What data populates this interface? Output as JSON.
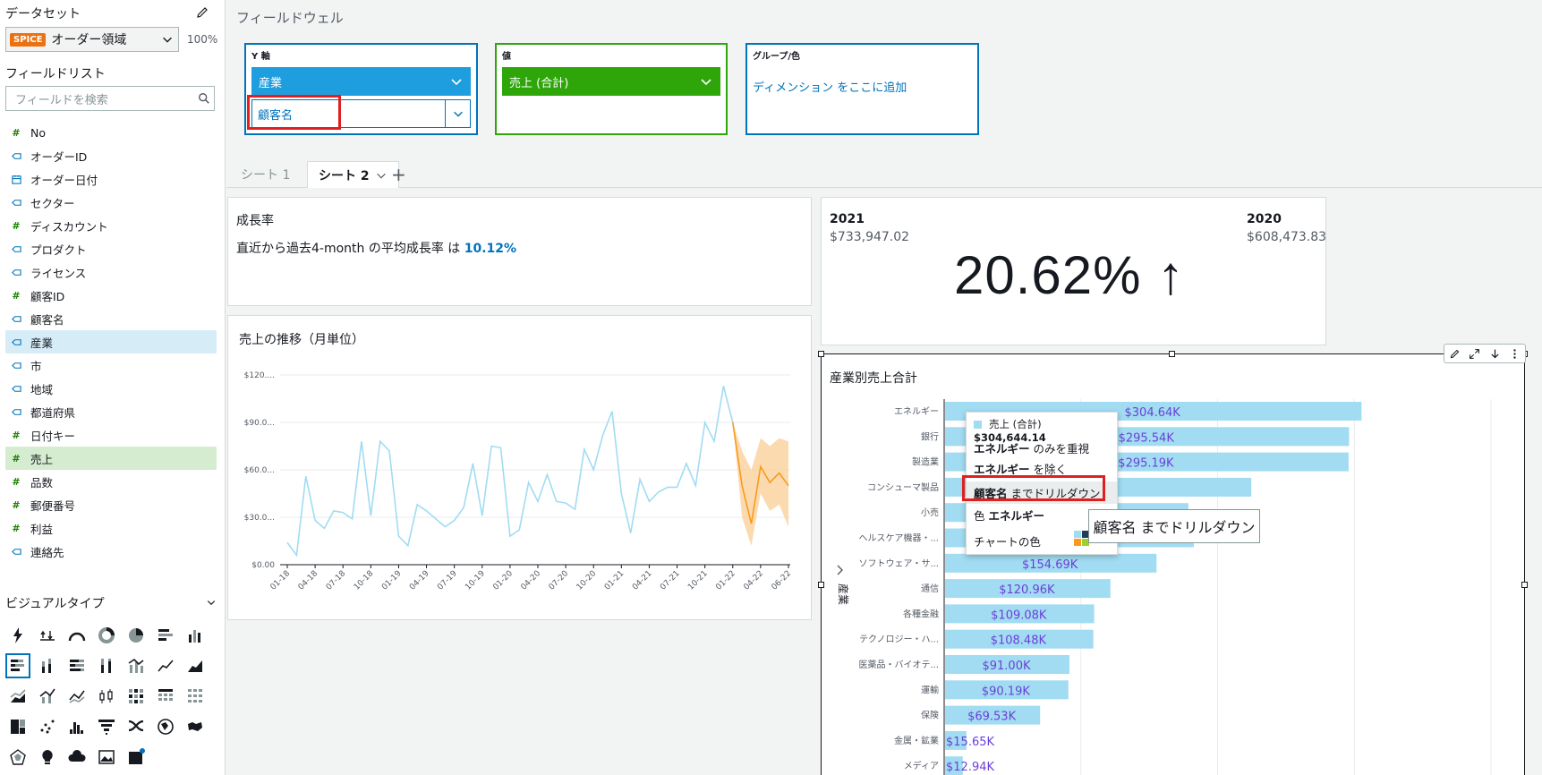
{
  "left_panel": {
    "dataset_label": "データセット",
    "spice_badge": "SPICE",
    "dataset_name": "オーダー領域",
    "dataset_percent": "100%",
    "field_list_label": "フィールドリスト",
    "search_placeholder": "フィールドを検索",
    "fields": [
      {
        "name": "No",
        "type": "hash",
        "state": ""
      },
      {
        "name": "オーダーID",
        "type": "tag",
        "state": ""
      },
      {
        "name": "オーダー日付",
        "type": "cal",
        "state": ""
      },
      {
        "name": "セクター",
        "type": "tag",
        "state": ""
      },
      {
        "name": "ディスカウント",
        "type": "hash",
        "state": ""
      },
      {
        "name": "プロダクト",
        "type": "tag",
        "state": ""
      },
      {
        "name": "ライセンス",
        "type": "tag",
        "state": ""
      },
      {
        "name": "顧客ID",
        "type": "hash",
        "state": ""
      },
      {
        "name": "顧客名",
        "type": "tag",
        "state": ""
      },
      {
        "name": "産業",
        "type": "tag",
        "state": "dim"
      },
      {
        "name": "市",
        "type": "tag",
        "state": ""
      },
      {
        "name": "地域",
        "type": "tag",
        "state": ""
      },
      {
        "name": "都道府県",
        "type": "tag",
        "state": ""
      },
      {
        "name": "日付キー",
        "type": "hash",
        "state": ""
      },
      {
        "name": "売上",
        "type": "hash",
        "state": "meas"
      },
      {
        "name": "品数",
        "type": "hash",
        "state": ""
      },
      {
        "name": "郵便番号",
        "type": "hash",
        "state": ""
      },
      {
        "name": "利益",
        "type": "hash",
        "state": ""
      },
      {
        "name": "連絡先",
        "type": "tag",
        "state": ""
      }
    ],
    "visual_types_label": "ビジュアルタイプ",
    "visual_types": [
      "autograph",
      "kpi",
      "gauge",
      "donut",
      "pie",
      "horizontal-bar",
      "vertical-bar",
      "stacked-horizontal-bar",
      "stacked-vertical-bar",
      "horizontal-100-bar",
      "vertical-100-bar",
      "combo-bar",
      "line",
      "area-line",
      "stacked-area",
      "combo-line",
      "multi-line",
      "box-plot",
      "heatmap",
      "pivot-table",
      "table",
      "treemap",
      "scatter",
      "histogram",
      "funnel",
      "sankey",
      "filled-map",
      "geo-map",
      "radar",
      "insight",
      "word-cloud",
      "image",
      "custom"
    ]
  },
  "field_wells": {
    "title": "フィールドウェル",
    "y_axis": {
      "label": "Y 軸",
      "field": "産業",
      "drill": "顧客名"
    },
    "value": {
      "label": "値",
      "field": "売上 (合計)"
    },
    "group": {
      "label": "グループ/色",
      "placeholder": "ディメンション をここに追加"
    }
  },
  "tabs": [
    {
      "label": "シート 1",
      "active": false
    },
    {
      "label": "シート 2",
      "active": true
    }
  ],
  "growth_card": {
    "title": "成長率",
    "text": "直近から過去4-month の平均成長率 は ",
    "value": "10.12%"
  },
  "kpi_card": {
    "year_left": "2021",
    "amount_left": "$733,947.02",
    "year_right": "2020",
    "amount_right": "$608,473.83",
    "value": "20.62% ↑"
  },
  "line_card": {
    "title": "売上の推移（月単位）"
  },
  "bar_card": {
    "title": "産業別売上合計",
    "y_axis_title": "産業"
  },
  "context_menu": {
    "header_label": "売上 (合計)",
    "header_value": "$304,644.14",
    "focus_bold": "エネルギー",
    "focus_rest": " のみを重視",
    "exclude_bold": "エネルギー",
    "exclude_rest": " を除く",
    "drill_bold": "顧客名",
    "drill_rest": " までドリルダウン",
    "color_prefix": "色 ",
    "color_bold": "エネルギー",
    "chart_color": "チャートの色"
  },
  "tooltip": "顧客名 までドリルダウン",
  "colors": {
    "accent": "#0073bb",
    "measure": "#2ea60a",
    "bar": "#a1dcf2",
    "bar_label": "#6b40d8",
    "forecast": "#f89b1c",
    "highlight_red": "#e02020"
  },
  "chart_data": [
    {
      "type": "line",
      "title": "売上の推移（月単位）",
      "x_ticks": [
        "01-18",
        "04-18",
        "07-18",
        "10-18",
        "01-19",
        "04-19",
        "07-19",
        "10-19",
        "01-20",
        "04-20",
        "07-20",
        "10-20",
        "01-21",
        "04-21",
        "07-21",
        "10-21",
        "01-22",
        "04-22",
        "06-22"
      ],
      "y_ticks": [
        "$0.00",
        "$30.0...",
        "$60.0...",
        "$90.0...",
        "$120...."
      ],
      "ylim": [
        0,
        120000
      ],
      "series": [
        {
          "values": [
            14000,
            6000,
            56000,
            28000,
            23000,
            34000,
            33000,
            29000,
            78000,
            31000,
            78000,
            72000,
            18000,
            12000,
            38000,
            34000,
            29000,
            24000,
            28000,
            36000,
            64000,
            31000,
            75000,
            74000,
            18000,
            22000,
            52000,
            40000,
            57000,
            40000,
            39000,
            35000,
            73000,
            60000,
            82000,
            97000,
            45000,
            20000,
            54000,
            40000,
            46000,
            49000,
            49000,
            64000,
            50000,
            90000,
            78000,
            113000,
            90000
          ]
        },
        {
          "role": "forecast",
          "start_index": 48,
          "values": [
            90000,
            50000,
            26000,
            62000,
            52000,
            58000,
            50000
          ],
          "upper": [
            90000,
            72000,
            60000,
            80000,
            75000,
            80000,
            78000
          ],
          "lower": [
            90000,
            30000,
            12000,
            45000,
            34000,
            38000,
            24000
          ]
        }
      ]
    },
    {
      "type": "bar",
      "orientation": "horizontal",
      "title": "産業別売上合計",
      "ylabel": "産業",
      "categories": [
        "エネルギー",
        "銀行",
        "製造業",
        "コンシューマ製品",
        "小売",
        "ヘルスケア機器・...",
        "ソフトウェア・サ...",
        "通信",
        "各種金融",
        "テクノロジー・ハ...",
        "医薬品・バイオテ...",
        "運輸",
        "保険",
        "金属・鉱業",
        "メディア"
      ],
      "values": [
        304640,
        295540,
        295190,
        224000,
        178000,
        182000,
        154690,
        120960,
        109080,
        108480,
        91000,
        90190,
        69530,
        15650,
        12940
      ],
      "data_labels": [
        "$304.64K",
        "$295.54K",
        "$295.19K",
        "",
        "",
        "",
        "$154.69K",
        "$120.96K",
        "$109.08K",
        "$108.48K",
        "$91.00K",
        "$90.19K",
        "$69.53K",
        "$15.65K",
        "$12.94K"
      ],
      "xlim": [
        0,
        400000
      ]
    }
  ]
}
